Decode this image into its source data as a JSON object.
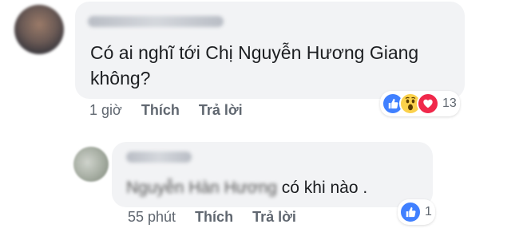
{
  "comment": {
    "text": "Có ai nghĩ tới Chị Nguyễn Hương Giang không?",
    "time": "1 giờ",
    "like_label": "Thích",
    "reply_label": "Trả lời",
    "reaction_count": "13",
    "reactions": [
      "like-icon",
      "wow-icon",
      "love-icon"
    ],
    "colors": {
      "like": "#4080ff",
      "wow": "#fbd14b",
      "love": "#f0284a",
      "bubble": "#f2f3f5",
      "meta": "#606770"
    }
  },
  "reply": {
    "text_visible": "có khi nào .",
    "time": "55 phút",
    "like_label": "Thích",
    "reply_label": "Trả lời",
    "reaction_count": "1",
    "reactions": [
      "like-icon"
    ]
  }
}
